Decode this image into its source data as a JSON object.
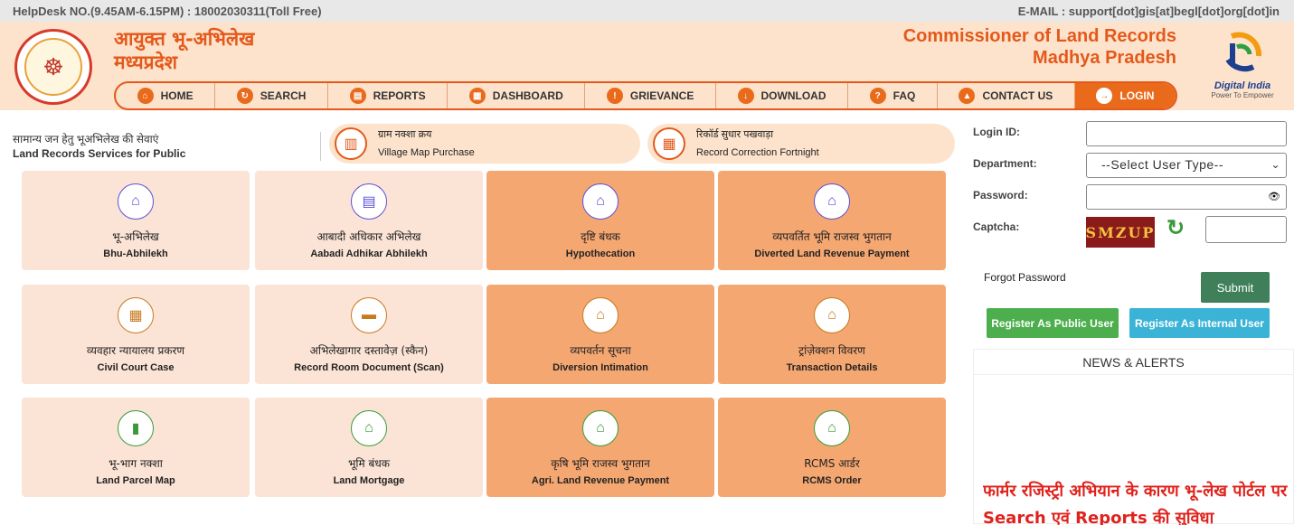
{
  "topbar": {
    "helpdesk": "HelpDesk NO.(9.45AM-6.15PM) : 18002030311(Toll Free)",
    "email": "E-MAIL : support[dot]gis[at]begl[dot]org[dot]in"
  },
  "header": {
    "title_hi_line1": "आयुक्त भू-अभिलेख",
    "title_hi_line2": "मध्यप्रदेश",
    "title_en_line1": "Commissioner of Land Records",
    "title_en_line2": "Madhya Pradesh",
    "digital_india": "Digital India",
    "digital_india_tag": "Power To Empower"
  },
  "nav": {
    "items": [
      {
        "label": "HOME",
        "icon": "home-icon"
      },
      {
        "label": "SEARCH",
        "icon": "refresh-search-icon"
      },
      {
        "label": "REPORTS",
        "icon": "document-icon"
      },
      {
        "label": "DASHBOARD",
        "icon": "dashboard-icon"
      },
      {
        "label": "GRIEVANCE",
        "icon": "chat-icon"
      },
      {
        "label": "DOWNLOAD",
        "icon": "download-icon"
      },
      {
        "label": "FAQ",
        "icon": "faq-icon"
      },
      {
        "label": "CONTACT US",
        "icon": "location-icon"
      },
      {
        "label": "LOGIN",
        "icon": "login-icon"
      }
    ]
  },
  "services": {
    "heading_hi": "सामान्य जन हेतु भूअभिलेख की सेवाएं",
    "heading_en": "Land Records Services for Public",
    "pill1_hi": "ग्राम नक्शा क्रय",
    "pill1_en": "Village Map Purchase",
    "pill2_hi": "रिकॉर्ड सुधार पखवाड़ा",
    "pill2_en": "Record Correction Fortnight"
  },
  "tiles": [
    {
      "hi": "भू-अभिलेख",
      "en": "Bhu-Abhilekh"
    },
    {
      "hi": "आबादी अधिकार अभिलेख",
      "en": "Aabadi Adhikar Abhilekh"
    },
    {
      "hi": "दृष्टि बंधक",
      "en": "Hypothecation"
    },
    {
      "hi": "व्यपवर्तित भूमि राजस्व भुगतान",
      "en": "Diverted Land Revenue Payment"
    },
    {
      "hi": "व्यवहार न्यायालय प्रकरण",
      "en": "Civil Court Case"
    },
    {
      "hi": "अभिलेखागार दस्तावेज़ (स्कैन)",
      "en": "Record Room Document (Scan)"
    },
    {
      "hi": "व्यपवर्तन सूचना",
      "en": "Diversion Intimation"
    },
    {
      "hi": "ट्रांज़ेक्शन विवरण",
      "en": "Transaction Details"
    },
    {
      "hi": "भू-भाग नक्शा",
      "en": "Land Parcel Map"
    },
    {
      "hi": "भूमि बंधक",
      "en": "Land Mortgage"
    },
    {
      "hi": "कृषि भूमि राजस्व भुगतान",
      "en": "Agri. Land Revenue Payment"
    },
    {
      "hi": "RCMS आर्डर",
      "en": "RCMS Order"
    }
  ],
  "login": {
    "login_id_label": "Login ID:",
    "department_label": "Department:",
    "department_value": "--Select User Type--",
    "password_label": "Password:",
    "captcha_label": "Captcha:",
    "captcha_text": "SMZUP",
    "forgot": "Forgot Password",
    "submit": "Submit",
    "register_public": "Register As Public User",
    "register_internal": "Register As Internal User",
    "news_heading": "NEWS & ALERTS",
    "news_text": "फार्मर रजिस्ट्री अभियान के कारण भू-लेख पोर्टल पर Search एवं Reports की सुविधा"
  },
  "colors": {
    "accent": "#e4591b",
    "header_bg": "#fde3cc",
    "tile_light": "#fbe4d6",
    "tile_dark": "#f5a771",
    "register_public": "#4cae4c",
    "register_internal": "#3bb3d6",
    "submit": "#3f7f5a"
  }
}
